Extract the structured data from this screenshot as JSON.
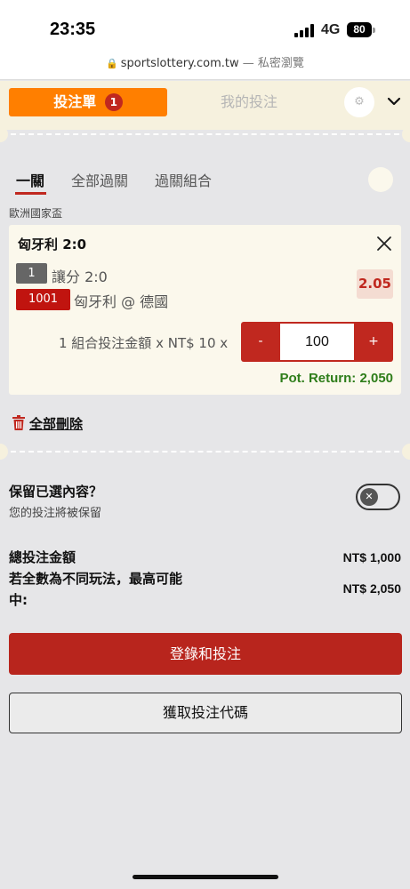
{
  "status_bar": {
    "time": "23:35",
    "network": "4G",
    "battery": "80"
  },
  "browser": {
    "domain": "sportslottery.com.tw",
    "mode": "— 私密瀏覽"
  },
  "header": {
    "betslip_label": "投注單",
    "betslip_count": "1",
    "mybets_label": "我的投注",
    "settings_icon": "gear-icon",
    "collapse_icon": "chevron-down-icon"
  },
  "tabs": [
    {
      "label": "一關",
      "active": true
    },
    {
      "label": "全部過關",
      "active": false
    },
    {
      "label": "過關組合",
      "active": false
    }
  ],
  "league": "歐洲國家盃",
  "selection_card": {
    "title": "匈牙利 2:0",
    "market_number": "1",
    "market_name": "讓分 2:0",
    "match_code": "1001",
    "selection": "匈牙利 @ 德國",
    "odds": "2.05",
    "stake_description": "1 組合投注金額 x NT$ 10 x",
    "stake_value": "100",
    "minus_label": "-",
    "plus_label": "+",
    "pot_return": "Pot. Return: 2,050"
  },
  "delete_all_label": "全部刪除",
  "keep_selection": {
    "title": "保留已選內容？",
    "subtitle": "您的投注將被保留",
    "toggle_state": "off"
  },
  "summary": {
    "total_stake_label": "總投注金額",
    "total_stake_value": "NT$ 1,000",
    "max_win_label_line1": "若全數為不同玩法，最高可能",
    "max_win_label_line2": "中:",
    "max_win_value": "NT$ 2,050"
  },
  "buttons": {
    "login_and_bet": "登錄和投注",
    "get_bet_code": "獲取投注代碼"
  },
  "colors": {
    "accent_orange": "#ff7f00",
    "primary_red": "#b8251d",
    "return_green": "#2e7d1a",
    "cream_background": "#f6f1de"
  }
}
